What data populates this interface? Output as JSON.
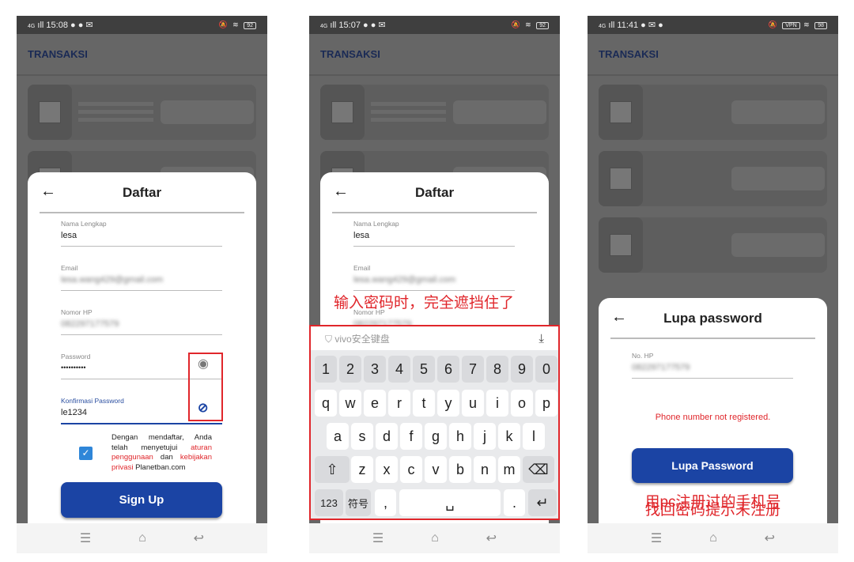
{
  "colors": {
    "accent": "#1b44a4",
    "error": "#e0262b",
    "annotation": "#e0262b"
  },
  "phones": [
    {
      "status": {
        "time": "15:08",
        "signal": "4G",
        "battery": "92"
      },
      "appbar_title": "TRANSAKSI",
      "modal": {
        "title": "Daftar",
        "back_icon": "arrow-left-icon",
        "fields": [
          {
            "label": "Nama Lengkap",
            "value": "lesa"
          },
          {
            "label": "Email",
            "value": "lesa.wang429@gmail.com"
          },
          {
            "label": "Nomor HP",
            "value": "082297177579"
          },
          {
            "label": "Password",
            "value": "••••••••••",
            "icon": "eye-icon"
          },
          {
            "label": "Konfirmasi Password",
            "value": "le1234",
            "icon": "eye-off-icon"
          }
        ],
        "terms": {
          "checked": true,
          "t1": "Dengan mendaftar, Anda telah menyetujui ",
          "l1": "aturan penggunaan",
          "t2": " dan ",
          "l2": "kebijakan privasi",
          "t3": " Planetban.com"
        },
        "submit": "Sign Up"
      }
    },
    {
      "status": {
        "time": "15:07",
        "signal": "4G",
        "battery": "92"
      },
      "appbar_title": "TRANSAKSI",
      "modal": {
        "title": "Daftar",
        "fields": [
          {
            "label": "Nama Lengkap",
            "value": "lesa"
          },
          {
            "label": "Email",
            "value": "lesa.wang429@gmail.com"
          },
          {
            "label": "Nomor HP",
            "value": "082297177579"
          }
        ]
      },
      "annotation": "输入密码时，完全遮挡住了",
      "keyboard": {
        "title": "vivo安全键盘",
        "rows": [
          [
            "1",
            "2",
            "3",
            "4",
            "5",
            "6",
            "7",
            "8",
            "9",
            "0"
          ],
          [
            "q",
            "w",
            "e",
            "r",
            "t",
            "y",
            "u",
            "i",
            "o",
            "p"
          ],
          [
            "a",
            "s",
            "d",
            "f",
            "g",
            "h",
            "j",
            "k",
            "l"
          ],
          [
            "⇧",
            "z",
            "x",
            "c",
            "v",
            "b",
            "n",
            "m",
            "⌫"
          ],
          [
            "123",
            "符号",
            ",",
            "␣",
            ".",
            "↵"
          ]
        ]
      }
    },
    {
      "status": {
        "time": "11:41",
        "signal": "4G",
        "vpn": "VPN",
        "battery": "98"
      },
      "appbar_title": "TRANSAKSI",
      "modal": {
        "title": "Lupa password",
        "field": {
          "label": "No. HP",
          "value": "082297177579"
        },
        "error": "Phone number not registered.",
        "submit": "Lupa Password"
      },
      "annotation": [
        "用pc注册过的手机号",
        "找回密码提示未注册"
      ]
    }
  ]
}
